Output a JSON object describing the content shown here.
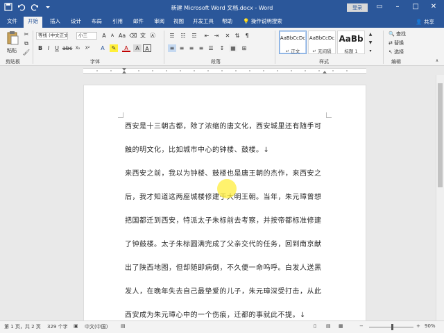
{
  "window": {
    "title": "新建 Microsoft Word 文档.docx - Word",
    "login_label": "登录"
  },
  "tabs": [
    "文件",
    "开始",
    "插入",
    "设计",
    "布局",
    "引用",
    "邮件",
    "审阅",
    "视图",
    "开发工具",
    "帮助"
  ],
  "tell_me": "操作说明搜索",
  "share_label": "共享",
  "ribbon": {
    "clipboard": {
      "paste_label": "粘贴",
      "group_label": "剪贴板"
    },
    "font": {
      "font_name": "等线 (中文正文)",
      "font_size": "小三",
      "group_label": "字体"
    },
    "paragraph": {
      "group_label": "段落"
    },
    "styles": {
      "group_label": "样式",
      "items": [
        {
          "preview": "AaBbCcDc",
          "name": "正文"
        },
        {
          "preview": "AaBbCcDc",
          "name": "无间隔"
        },
        {
          "preview": "AaBb",
          "name": "标题 1"
        }
      ]
    },
    "editing": {
      "find_label": "查找",
      "replace_label": "替换",
      "select_label": "选择",
      "group_label": "编辑"
    }
  },
  "document": {
    "lines": [
      "西安是十三朝古都，除了浓缩的唐文化，西安城里还有随手可",
      "触的明文化，比如城市中心的钟楼、鼓楼。↓",
      "来西安之前，我以为钟楼、鼓楼也是唐王朝的杰作，来西安之",
      "后，我才知道这两座城楼修建于大明王朝。当年，朱元璋曾想",
      "把国都迁到西安，特派太子朱标前去考察，并按帝都标准修建",
      "了钟鼓楼。太子朱标圆满完成了父亲交代的任务，回到南京献",
      "出了陕西地图，但却随即病倒，不久便一命呜呼。白发人送黑",
      "发人，在晚年失去自己最挚爱的儿子，朱元璋深受打击，从此",
      "西安成为朱元璋心中的一个伤痕，迁都的事就此不提。↓"
    ]
  },
  "status": {
    "page": "第 1 页，共 2 页",
    "words": "329 个字",
    "language": "中文(中国)",
    "zoom": "90%"
  },
  "colors": {
    "accent": "#2b579a",
    "highlight": "#ffee3c"
  }
}
